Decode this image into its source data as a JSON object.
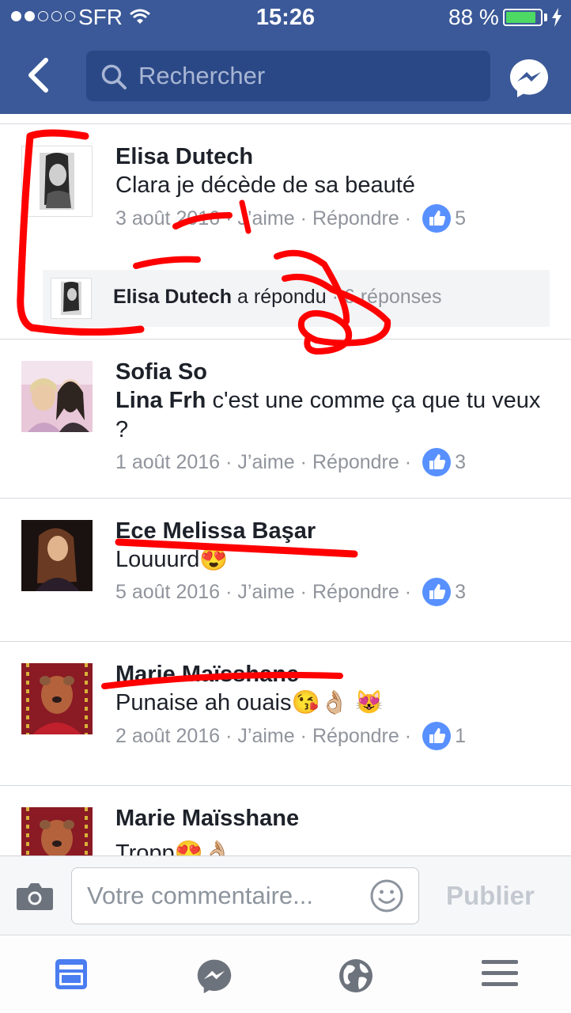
{
  "status_bar": {
    "carrier": "SFR",
    "time": "15:26",
    "battery": "88 %",
    "battery_level": 0.88
  },
  "header": {
    "search_placeholder": "Rechercher"
  },
  "comments": [
    {
      "name": "Elisa Dutech",
      "text": "Clara je décède de sa beauté",
      "date": "3 août 2016",
      "like_label": "J’aime",
      "reply_label": "Répondre",
      "likes": "5",
      "reply": {
        "name": "Elisa Dutech",
        "action": "a répondu",
        "count": "6 réponses"
      }
    },
    {
      "name": "Sofia So",
      "tag": "Lina Frh",
      "text": " c'est une comme ça que tu veux ?",
      "date": "1 août 2016",
      "like_label": "J’aime",
      "reply_label": "Répondre",
      "likes": "3"
    },
    {
      "name": "Ece Melissa Başar",
      "text": "Louuurd😍",
      "date": "5 août 2016",
      "like_label": "J’aime",
      "reply_label": "Répondre",
      "likes": "3"
    },
    {
      "name": "Marie Maïsshane",
      "text": "Punaise ah ouais😘👌🏼 😻",
      "date": "2 août 2016",
      "like_label": "J’aime",
      "reply_label": "Répondre",
      "likes": "1"
    },
    {
      "name": "Marie Maïsshane",
      "text": "Tropp😍👌🏼"
    }
  ],
  "composer": {
    "placeholder": "Votre commentaire...",
    "publish_label": "Publier"
  },
  "colors": {
    "header": "#3b5998",
    "like_badge": "#5890ff",
    "annotation": "#ff0000"
  }
}
